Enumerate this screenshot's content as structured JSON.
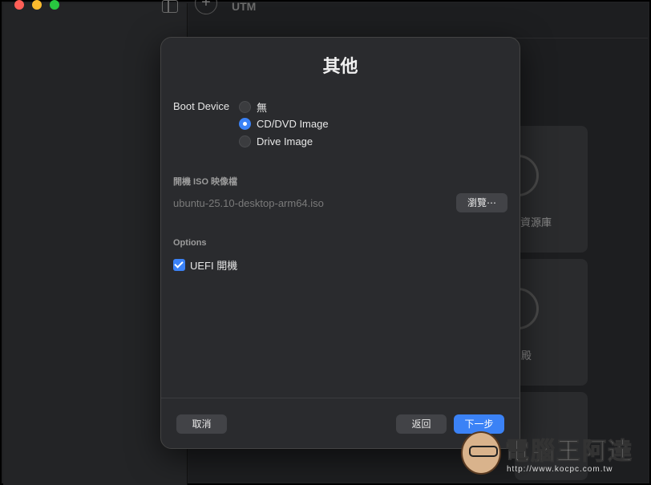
{
  "background": {
    "app_title": "UTM",
    "plus_label": "+",
    "cards": [
      {
        "label": "| 資源庫"
      },
      {
        "label": "殿"
      }
    ]
  },
  "dialog": {
    "title": "其他",
    "boot_device": {
      "label": "Boot Device",
      "options": [
        {
          "label": "無",
          "selected": false
        },
        {
          "label": "CD/DVD Image",
          "selected": true
        },
        {
          "label": "Drive Image",
          "selected": false
        }
      ]
    },
    "iso": {
      "section_label": "開機 ISO 映像檔",
      "path": "ubuntu-25.10-desktop-arm64.iso",
      "browse_label": "瀏覽⋯"
    },
    "options": {
      "section_label": "Options",
      "uefi_label": "UEFI 開機",
      "uefi_checked": true
    },
    "footer": {
      "cancel_label": "取消",
      "back_label": "返回",
      "next_label": "下一步"
    }
  },
  "watermark": {
    "text": "電腦王阿達",
    "url": "http://www.kocpc.com.tw"
  },
  "colors": {
    "accent": "#3b82f6",
    "dialog_bg": "#2a2b2e",
    "window_bg": "#1f2022"
  }
}
